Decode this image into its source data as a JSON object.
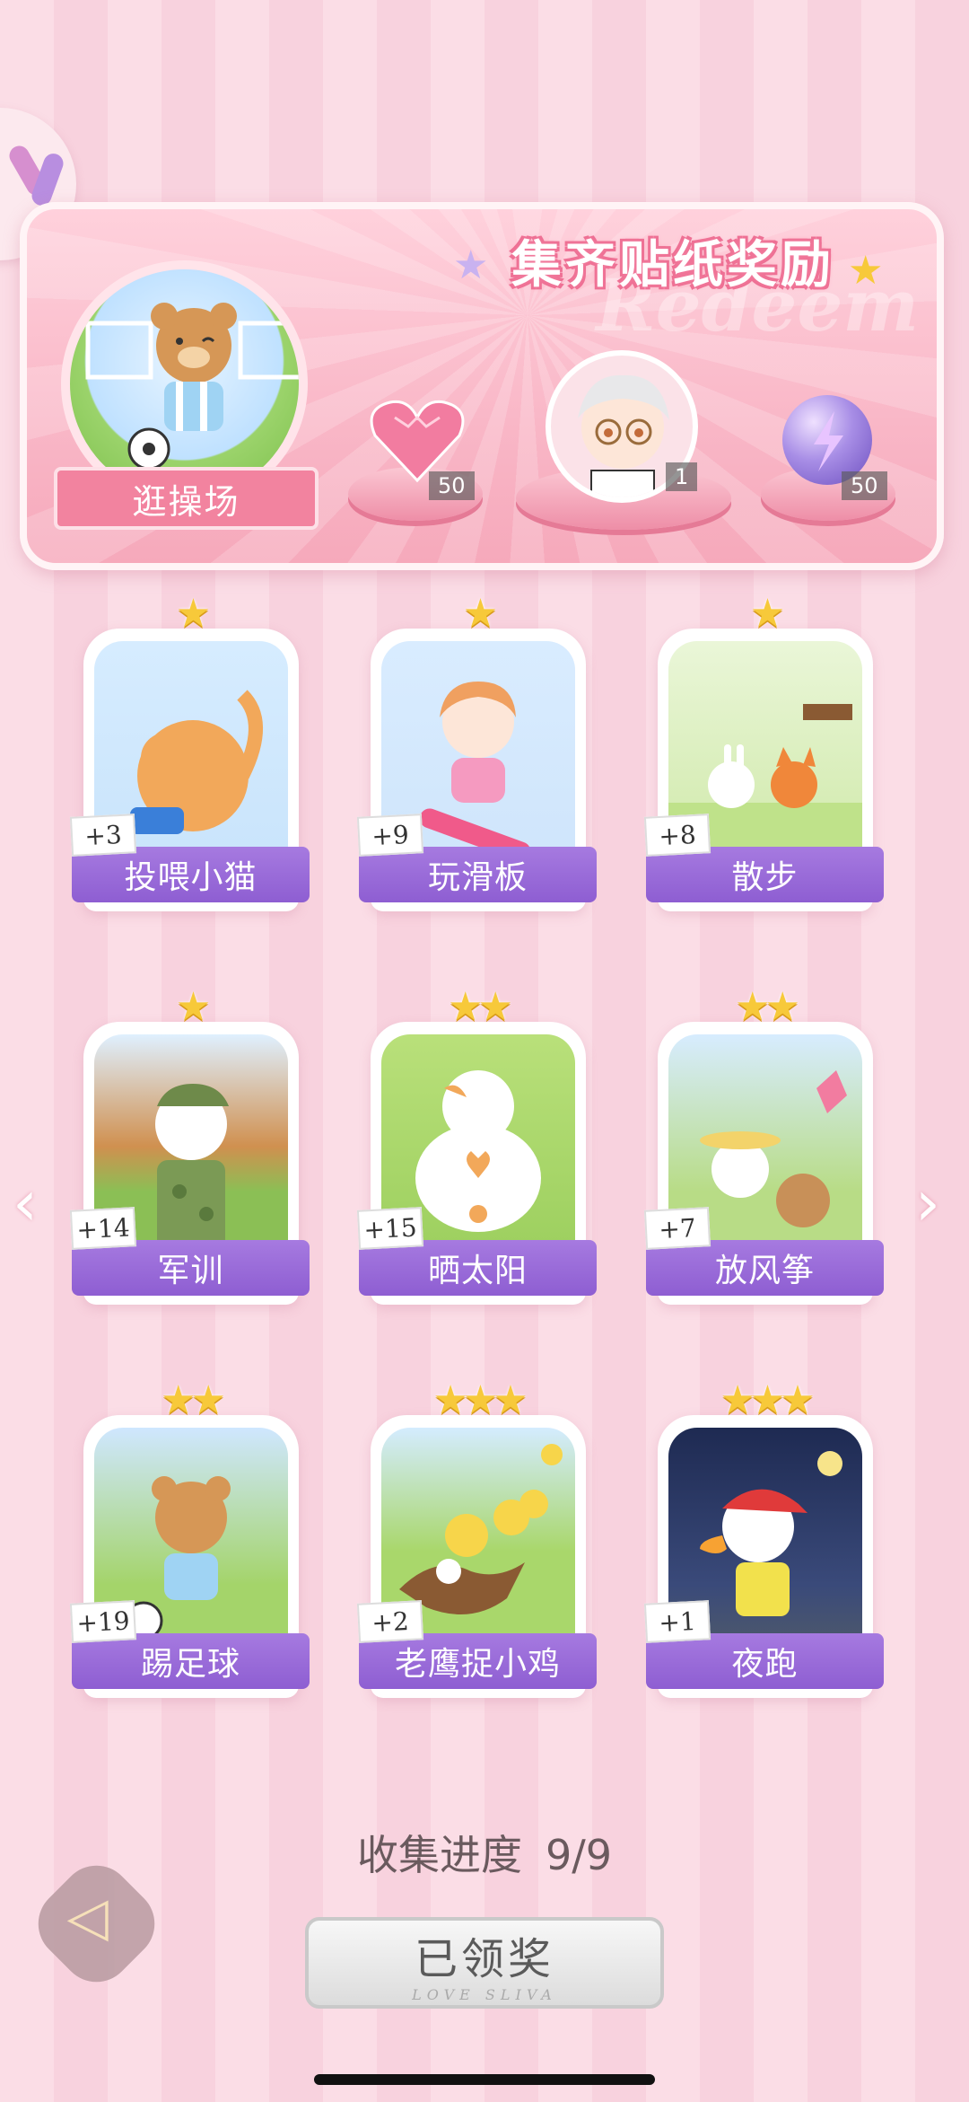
{
  "header": {
    "title": "集齐贴纸奖励",
    "watermark": "Redeem",
    "location_label": "逛操场",
    "rewards": [
      {
        "name": "pink-heart-gem",
        "count": "50"
      },
      {
        "name": "character-avatar",
        "count": "1"
      },
      {
        "name": "purple-lightning-orb",
        "count": "50"
      }
    ]
  },
  "cards": [
    {
      "label": "投喂小猫",
      "points": "+3",
      "stars": "★",
      "icon": "orange-cat-eating"
    },
    {
      "label": "玩滑板",
      "points": "+9",
      "stars": "★",
      "icon": "girl-skateboard"
    },
    {
      "label": "散步",
      "points": "+8",
      "stars": "★",
      "icon": "bunny-fox-walk"
    },
    {
      "label": "军训",
      "points": "+14",
      "stars": "★",
      "icon": "soldier-cat"
    },
    {
      "label": "晒太阳",
      "points": "+15",
      "stars": "★★",
      "icon": "sunbathing-cat"
    },
    {
      "label": "放风筝",
      "points": "+7",
      "stars": "★★",
      "icon": "bunny-kite"
    },
    {
      "label": "踢足球",
      "points": "+19",
      "stars": "★★",
      "icon": "bear-soccer"
    },
    {
      "label": "老鹰捉小鸡",
      "points": "+2",
      "stars": "★★★",
      "icon": "eagle-chicks"
    },
    {
      "label": "夜跑",
      "points": "+1",
      "stars": "★★★",
      "icon": "duck-night-run"
    }
  ],
  "progress": {
    "label": "收集进度",
    "value": "9/9"
  },
  "claim_button": {
    "label": "已领奖",
    "sub": "LOVE SLIVA"
  },
  "colors": {
    "band": "#8e5ed2",
    "pink": "#f2839f",
    "star": "#f7c93a"
  }
}
